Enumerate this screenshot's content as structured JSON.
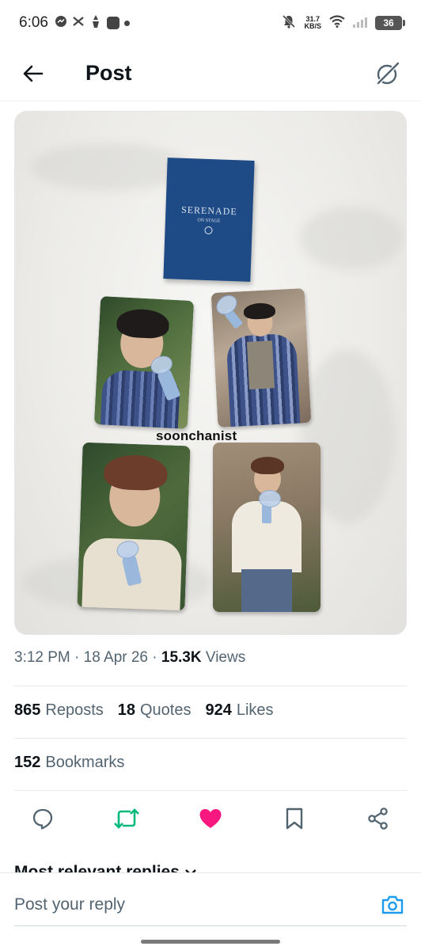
{
  "status_bar": {
    "time": "6:06",
    "net_speed_value": "31.7",
    "net_speed_unit": "KB/S",
    "battery": "36"
  },
  "header": {
    "title": "Post"
  },
  "post": {
    "watermark": "soonchanist",
    "booklet_title": "SERENADE",
    "booklet_subtitle": "ON STAGE",
    "time": "3:12 PM",
    "date": "18 Apr 26",
    "views_count": "15.3K",
    "views_label": "Views",
    "reposts_count": "865",
    "reposts_label": "Reposts",
    "quotes_count": "18",
    "quotes_label": "Quotes",
    "likes_count": "924",
    "likes_label": "Likes",
    "bookmarks_count": "152",
    "bookmarks_label": "Bookmarks"
  },
  "replies": {
    "sort_label": "Most relevant replies"
  },
  "reply_bar": {
    "placeholder": "Post your reply"
  },
  "colors": {
    "repost_green": "#00ba7c",
    "like_pink": "#f91880",
    "camera_blue": "#1d9bf0",
    "secondary_text": "#536471"
  }
}
